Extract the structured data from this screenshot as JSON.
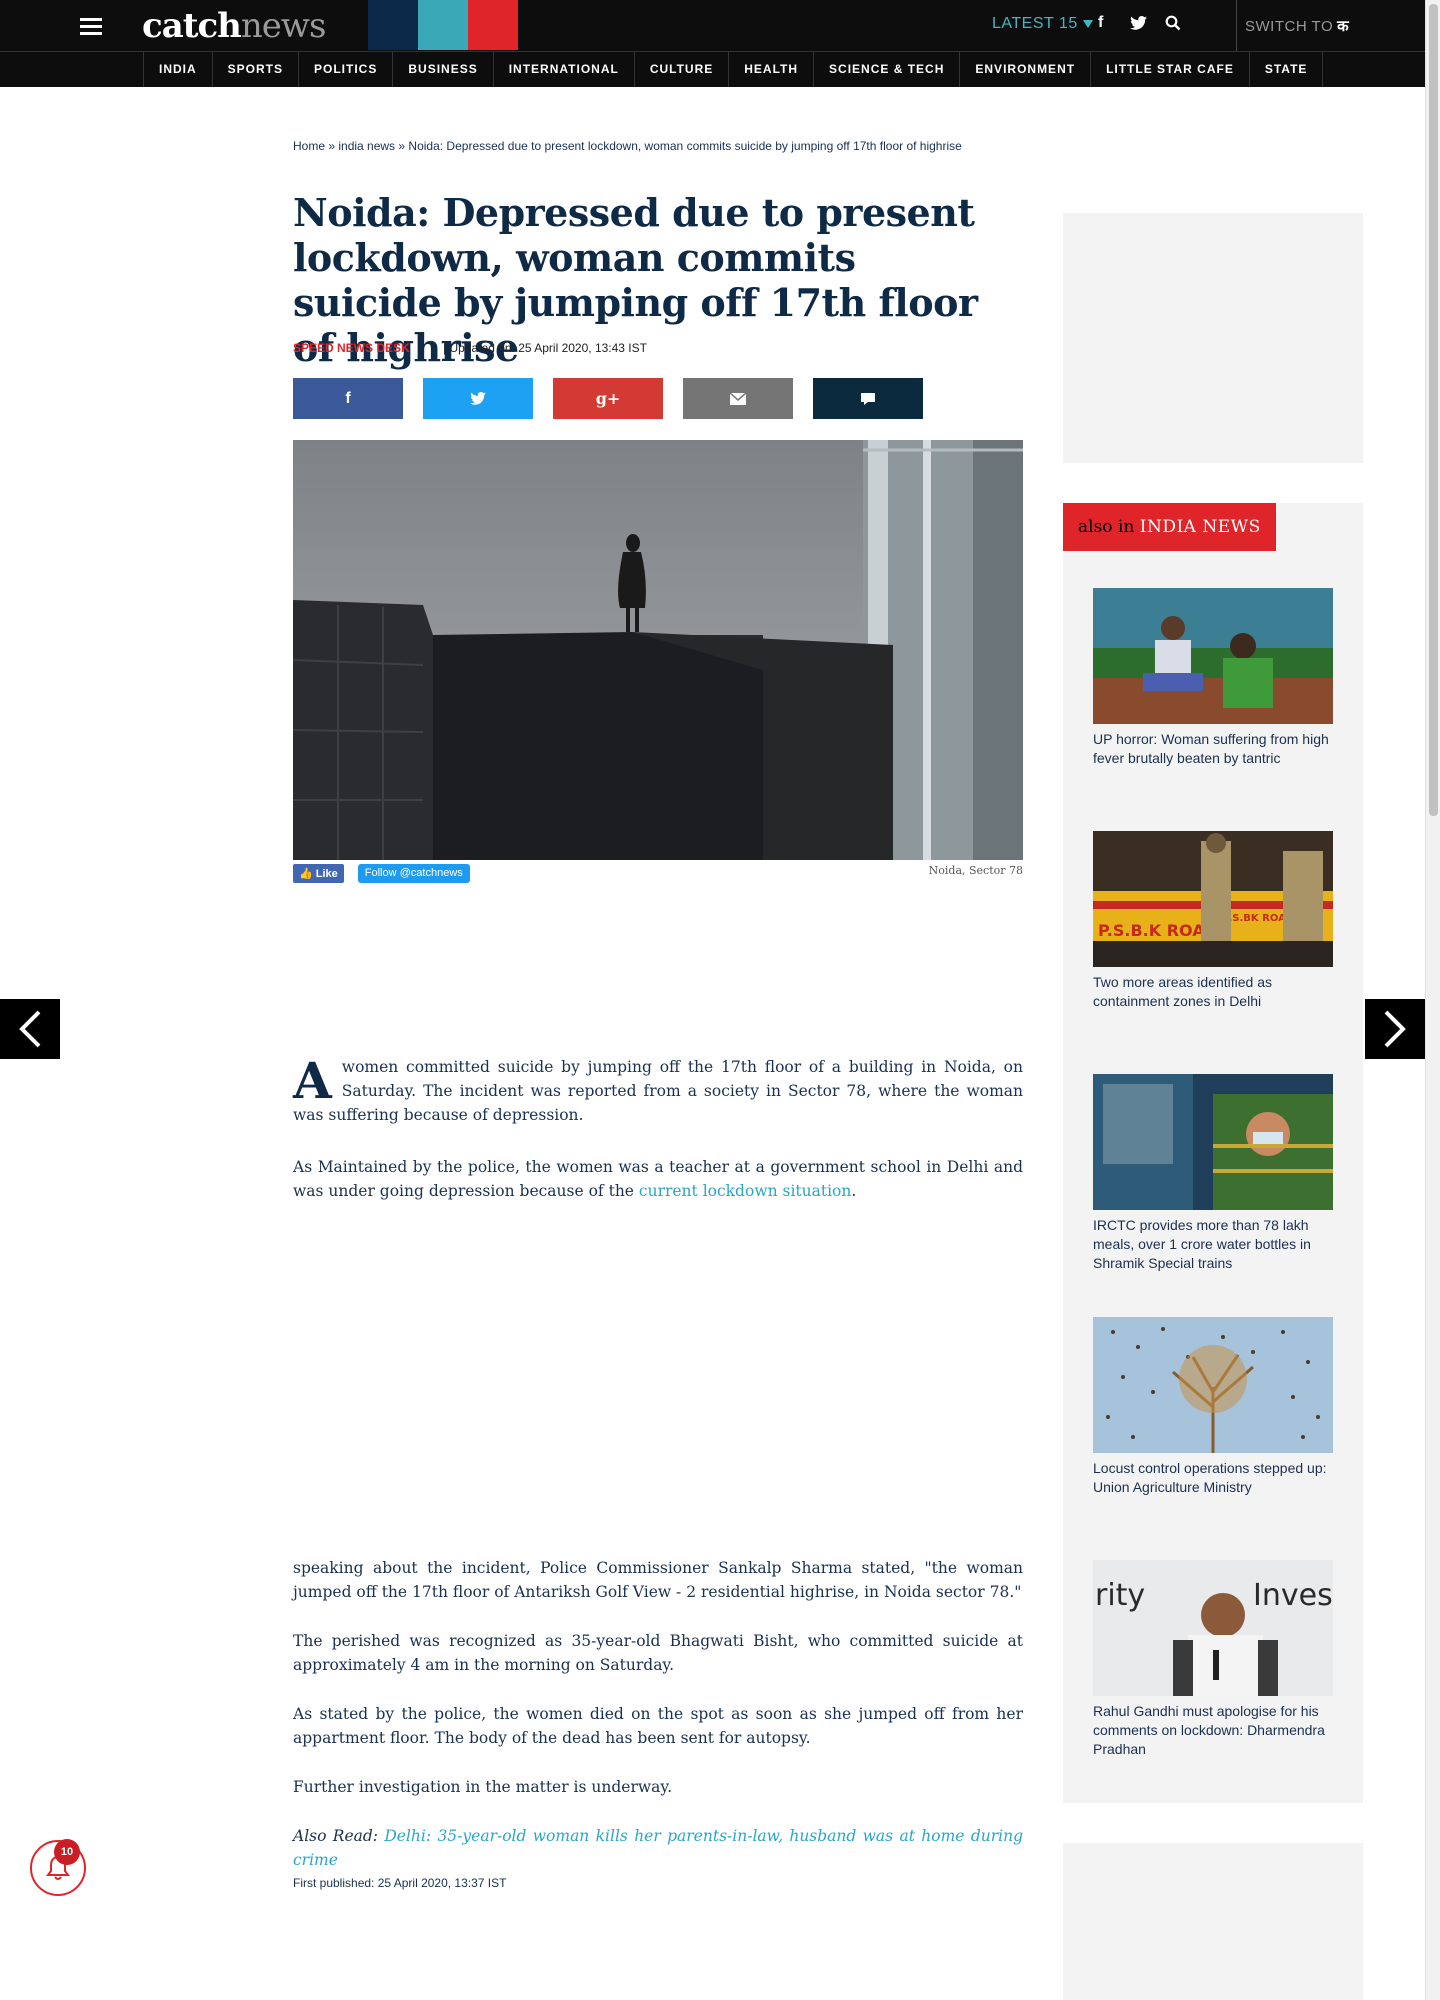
{
  "header": {
    "logo_catch": "catch",
    "logo_news": "news",
    "latest_label": "LATEST 15",
    "switch_to_label": "SWITCH TO",
    "switch_to_lang": "क",
    "brand_colors": [
      "#0b2a4a",
      "#3aa8b6",
      "#e0252a"
    ]
  },
  "nav": {
    "items": [
      "INDIA",
      "SPORTS",
      "POLITICS",
      "BUSINESS",
      "INTERNATIONAL",
      "CULTURE",
      "HEALTH",
      "SCIENCE & TECH",
      "ENVIRONMENT",
      "LITTLE STAR CAFE",
      "STATE"
    ]
  },
  "article": {
    "breadcrumb": {
      "home": "Home",
      "section": "india news",
      "current": "Noida: Depressed due to present lockdown, woman commits suicide by jumping off 17th floor of highrise"
    },
    "title": "Noida: Depressed due to present lockdown, woman commits suicide by jumping off 17th floor of highrise",
    "author": "SPEED NEWS DESK",
    "updated": "| Updated on: 25 April 2020, 13:43 IST",
    "share_buttons": [
      {
        "network": "facebook",
        "glyph": "f",
        "color": "#3b5998"
      },
      {
        "network": "twitter",
        "glyph": "t",
        "color": "#1da1f2"
      },
      {
        "network": "google-plus",
        "glyph": "g+",
        "color": "#d23a33"
      },
      {
        "network": "email",
        "glyph": "✉",
        "color": "#757575"
      },
      {
        "network": "comment",
        "glyph": "▪",
        "color": "#0b2a3d"
      }
    ],
    "fb_like": "Like",
    "tw_follow": "Follow @catchnews",
    "image_caption": "Noida, Sector 78",
    "dropcap": "A",
    "p1": "women committed suicide by jumping off the 17th floor of a building in Noida, on Saturday. The incident was reported from a society in Sector 78, where the woman was suffering because of depression.",
    "p2_before": "As Maintained by the police, the women was a teacher at a government school in Delhi and was under going depression because of the ",
    "p2_link": "current lockdown situation",
    "p2_after": ".",
    "p3": "speaking about the incident, Police Commissioner Sankalp Sharma stated, \"the woman jumped off the 17th floor of Antariksh Golf View - 2 residential highrise, in Noida sector 78.\"",
    "p4": "The perished was recognized as 35-year-old Bhagwati Bisht, who committed suicide at approximately 4 am in the morning on Saturday.",
    "p5": "As stated by the police, the women died on the spot as soon as she jumped off from her appartment floor. The body of the dead has been sent for autopsy.",
    "p6": "Further investigation in the matter is underway.",
    "also_read_label": "Also Read:",
    "also_read_link": "Delhi: 35-year-old woman kills her parents-in-law, husband was at home during crime",
    "first_published": "First published: 25 April 2020, 13:37 IST"
  },
  "sidebar": {
    "also_in": "also in",
    "category": "INDIA NEWS",
    "stories": [
      {
        "caption": "UP horror: Woman suffering from high fever brutally beaten by tantric"
      },
      {
        "caption": "Two more areas identified as containment zones in Delhi"
      },
      {
        "caption": "IRCTC provides more than 78 lakh meals, over 1 crore water bottles in Shramik Special trains"
      },
      {
        "caption": "Locust control operations stepped up: Union Agriculture Ministry"
      },
      {
        "caption": "Rahul Gandhi must apologise for his comments on lockdown: Dharmendra Pradhan"
      }
    ]
  },
  "notifications": {
    "count": "10"
  },
  "scroll": {
    "position_fraction": 0.0
  }
}
